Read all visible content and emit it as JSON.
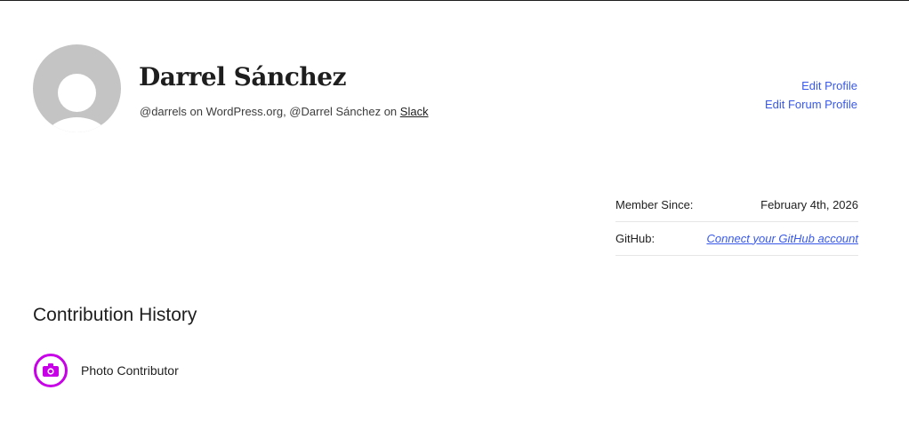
{
  "profile": {
    "name": "Darrel Sánchez",
    "handle_prefix": "@darrels on WordPress.org, @Darrel Sánchez on ",
    "slack_link": "Slack"
  },
  "actions": {
    "edit_profile": "Edit Profile",
    "edit_forum_profile": "Edit Forum Profile"
  },
  "meta": {
    "member_since_label": "Member Since:",
    "member_since_value": "February 4th, 2026",
    "github_label": "GitHub:",
    "github_link": "Connect your GitHub account"
  },
  "contributions": {
    "title": "Contribution History",
    "badges": [
      {
        "label": "Photo Contributor",
        "icon": "camera-icon",
        "color": "#c700e8"
      }
    ]
  },
  "colors": {
    "link": "#3858e9",
    "badge": "#c700e8",
    "avatar": "#c4c4c4"
  }
}
